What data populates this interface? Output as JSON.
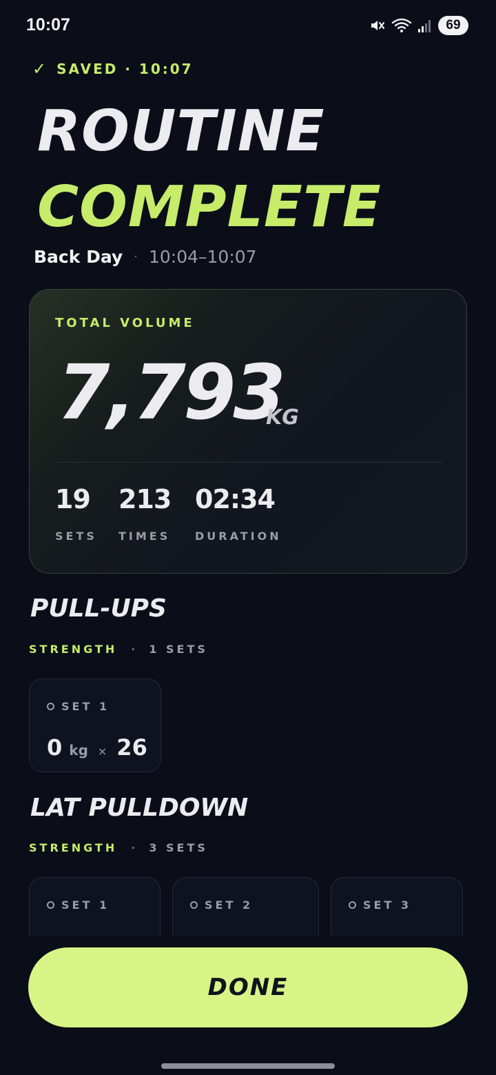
{
  "status_bar": {
    "time": "10:07",
    "battery": "69",
    "icons": [
      "mute-icon",
      "wifi-icon",
      "signal-icon",
      "battery-icon"
    ]
  },
  "saved": {
    "check": "✓",
    "label": "SAVED · 10:07"
  },
  "headline": {
    "line1": "ROUTINE",
    "line2": "COMPLETE"
  },
  "routine": {
    "name": "Back Day",
    "separator": "·",
    "time_range": "10:04–10:07"
  },
  "summary": {
    "label": "TOTAL VOLUME",
    "value": "7,793",
    "unit": "KG",
    "stats": [
      {
        "value": "19",
        "label": "SETS"
      },
      {
        "value": "213",
        "label": "TIMES"
      },
      {
        "value": "02:34",
        "label": "DURATION"
      }
    ]
  },
  "exercises": [
    {
      "name": "PULL-UPS",
      "type": "STRENGTH",
      "separator": "·",
      "sets_label": "1 SETS",
      "sets": [
        {
          "label": "SET 1",
          "weight": "0",
          "unit": "kg",
          "times": "×",
          "reps": "26"
        }
      ]
    },
    {
      "name": "LAT PULLDOWN",
      "type": "STRENGTH",
      "separator": "·",
      "sets_label": "3 SETS",
      "sets": [
        {
          "label": "SET 1"
        },
        {
          "label": "SET 2"
        },
        {
          "label": "SET 3"
        }
      ]
    }
  ],
  "done_button": {
    "label": "DONE"
  },
  "colors": {
    "background": "#0b0e19",
    "accent": "#c6ec6a",
    "button": "#d8f487",
    "text": "#ecebf0",
    "muted": "#9a9ca8"
  }
}
